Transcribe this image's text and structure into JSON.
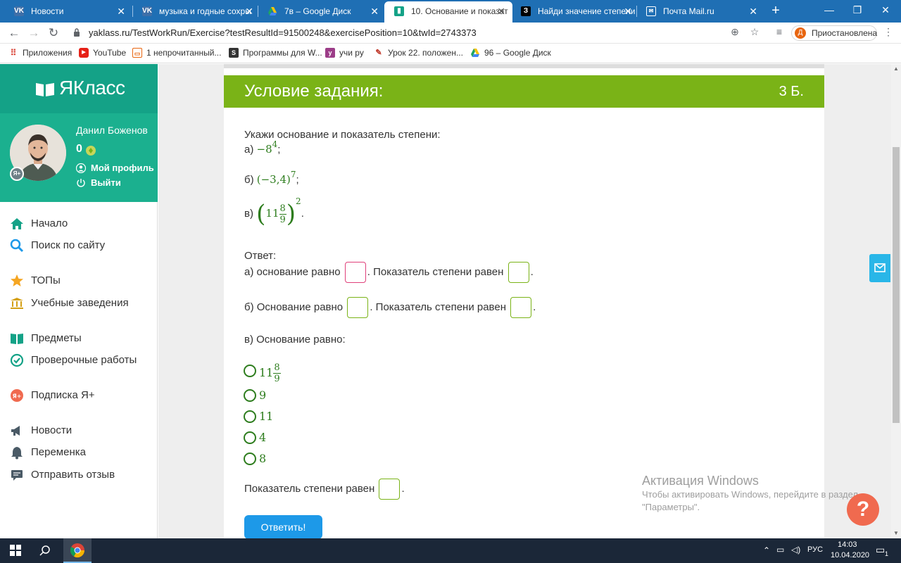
{
  "browser": {
    "tabs": [
      {
        "label": "Новости",
        "icon": "vk-icon",
        "active": false
      },
      {
        "label": "музыка и годные сохры",
        "icon": "vk-icon",
        "active": false
      },
      {
        "label": "7в – Google Диск",
        "icon": "google-drive-icon",
        "active": false
      },
      {
        "label": "10. Основание и показат",
        "icon": "yaklass-icon",
        "active": true
      },
      {
        "label": "Найди значение степени",
        "icon": "znanija-icon",
        "active": false
      },
      {
        "label": "Почта Mail.ru",
        "icon": "mail-icon",
        "active": false
      }
    ],
    "url": "yaklass.ru/TestWorkRun/Exercise?testResultId=91500248&exercisePosition=10&twId=2743373",
    "profile_letter": "Д",
    "profile_status": "Приостановлена",
    "bookmarks": [
      {
        "label": "Приложения",
        "icon": "apps-icon"
      },
      {
        "label": "YouTube",
        "icon": "youtube-icon"
      },
      {
        "label": "1 непрочитанный...",
        "icon": "mail-bookmark-icon"
      },
      {
        "label": "Программы для W...",
        "icon": "s-icon"
      },
      {
        "label": "учи ру",
        "icon": "uchi-icon"
      },
      {
        "label": "Урок 22. положен...",
        "icon": "lesson-icon"
      },
      {
        "label": "96 – Google Диск",
        "icon": "google-drive-icon"
      }
    ]
  },
  "sidebar": {
    "brand": "ЯКласс",
    "user_name": "Данил Боженов",
    "points": "0",
    "ya_badge": "Я+",
    "links": {
      "profile": "Мой профиль",
      "logout": "Выйти"
    },
    "nav": [
      {
        "label": "Начало",
        "icon": "home-icon"
      },
      {
        "label": "Поиск по сайту",
        "icon": "search-icon"
      },
      {
        "label": "ТОПы",
        "icon": "star-icon"
      },
      {
        "label": "Учебные заведения",
        "icon": "school-icon"
      },
      {
        "label": "Предметы",
        "icon": "book-icon"
      },
      {
        "label": "Проверочные работы",
        "icon": "check-circle-icon"
      },
      {
        "label": "Подписка Я+",
        "icon": "subscription-icon"
      },
      {
        "label": "Новости",
        "icon": "megaphone-icon"
      },
      {
        "label": "Переменка",
        "icon": "bell-icon"
      },
      {
        "label": "Отправить отзыв",
        "icon": "feedback-icon"
      }
    ]
  },
  "task": {
    "banner_title": "Условие задания:",
    "banner_points": "3 Б.",
    "prompt": "Укажи основание и показатель степени:",
    "item_a": {
      "prefix": "а)",
      "base": "−8",
      "exp": "4",
      "suffix": ";"
    },
    "item_b": {
      "prefix": "б)",
      "base": "(−3,4)",
      "exp": "7",
      "suffix": ";"
    },
    "item_c": {
      "prefix": "в)",
      "whole": "11",
      "num": "8",
      "den": "9",
      "exp": "2",
      "suffix": "."
    },
    "answer_label": "Ответ:",
    "answer_a_base": "а) основание равно",
    "answer_a_exp": ". Показатель степени равен",
    "answer_b_base": "б) Основание равно",
    "answer_b_exp": ". Показатель степени равен",
    "period": ".",
    "answer_c_base": "в) Основание равно:",
    "options": [
      {
        "label": "11",
        "num": "8",
        "den": "9"
      },
      {
        "label": "9"
      },
      {
        "label": "11"
      },
      {
        "label": "4"
      },
      {
        "label": "8"
      }
    ],
    "answer_c_exp": "Показатель степени равен",
    "submit": "Ответить!"
  },
  "overlay": {
    "activation_title": "Активация Windows",
    "activation_line1": "Чтобы активировать Windows, перейдите в раздел",
    "activation_line2": "\"Параметры\".",
    "help": "?"
  },
  "taskbar": {
    "lang": "РУС",
    "time": "14:03",
    "date": "10.04.2020",
    "notifications": "1"
  },
  "colors": {
    "tabbar": "#1f6fb4",
    "brand": "#14a287",
    "banner": "#7ab317",
    "math": "#2e7d1e",
    "submit": "#1d99e8",
    "help": "#f06a4f"
  }
}
